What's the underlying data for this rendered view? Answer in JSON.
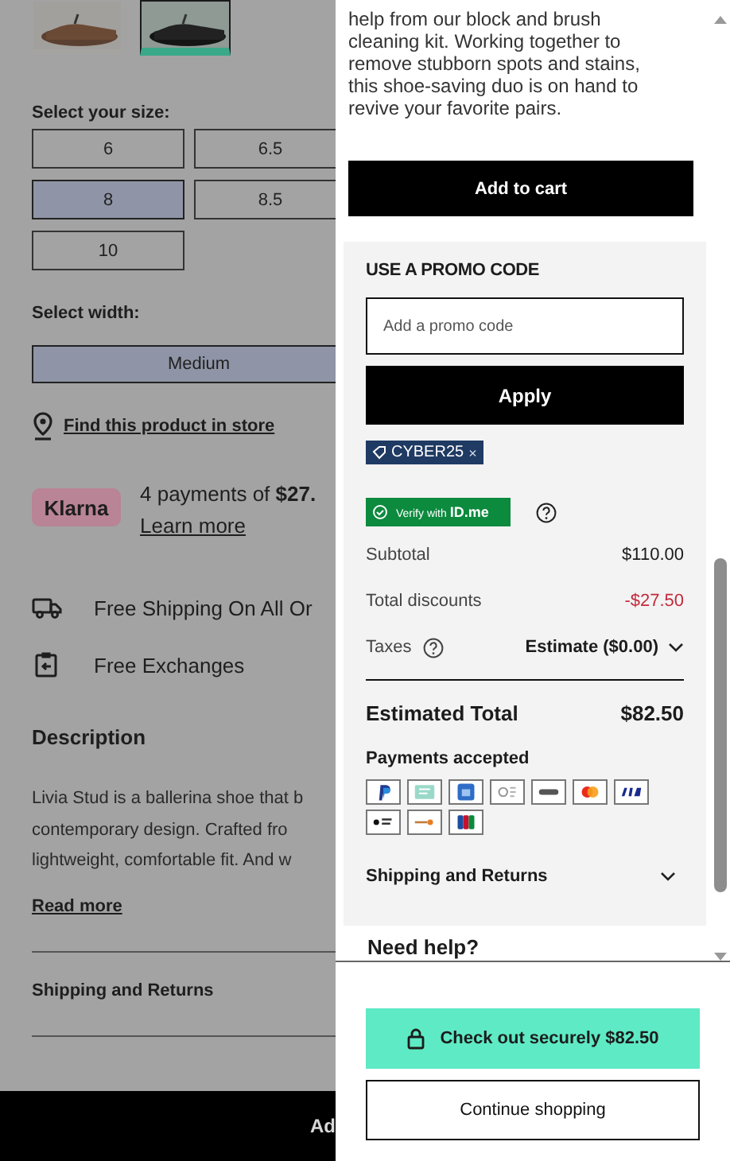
{
  "product_page": {
    "thumbnails": [
      {
        "kind": "picture",
        "selected": false
      },
      {
        "kind": "picture",
        "selected": true
      }
    ],
    "size_label": "Select your size:",
    "sizes": [
      {
        "label": "6",
        "selected": false
      },
      {
        "label": "6.5",
        "selected": false
      },
      {
        "label": "8",
        "selected": true
      },
      {
        "label": "8.5",
        "selected": false
      },
      {
        "label": "10",
        "selected": false
      }
    ],
    "width_label": "Select width:",
    "widths": [
      {
        "label": "Medium",
        "selected": true
      }
    ],
    "store_link": "Find this product in store",
    "klarna": {
      "badge": "Klarna",
      "text": "4 payments of **$27.**",
      "link": "Learn more"
    },
    "perks": [
      {
        "kind": "shipping",
        "text": "Free Shipping On All Or"
      },
      {
        "kind": "exchange",
        "text": "Free Exchanges"
      }
    ],
    "description": {
      "title": "Description",
      "lines": [
        "Livia Stud is a ballerina shoe that b",
        "contemporary design. Crafted fro",
        "lightweight, comfortable fit. And w"
      ],
      "link": "Read more"
    },
    "sections": [
      {
        "title": "Shipping and Returns"
      }
    ],
    "bottom_button": "Ad"
  },
  "cart": {
    "product_lines": [
      "help from our block and brush",
      "cleaning kit. Working together to",
      "remove stubborn spots and stains,",
      "this shoe-saving duo is on hand to",
      "revive your favorite pairs."
    ],
    "add_to_cart": "Add to cart",
    "promo": {
      "title": "USE A PROMO CODE",
      "placeholder": "Add a promo code",
      "apply": "Apply",
      "codes": [
        {
          "code": "CYBER25",
          "remove": "×"
        }
      ],
      "verify": "Verify with **ID.me**"
    },
    "summary": [
      {
        "kind": "plain",
        "label": "Subtotal",
        "value": "$110.00"
      },
      {
        "kind": "discount",
        "label": "Total discounts",
        "value": "-$27.50"
      },
      {
        "kind": "taxes",
        "label": "Taxes",
        "value": "Estimate ($0.00)",
        "expanded": false
      }
    ],
    "total": {
      "label": "Estimated Total",
      "value": "$82.50"
    },
    "payments_title": "Payments accepted",
    "accordion": {
      "title": "Shipping and Returns",
      "expanded": false
    },
    "help_title": "Need help?",
    "checkout": "Check out securely $82.50",
    "continue": "Continue shopping"
  }
}
